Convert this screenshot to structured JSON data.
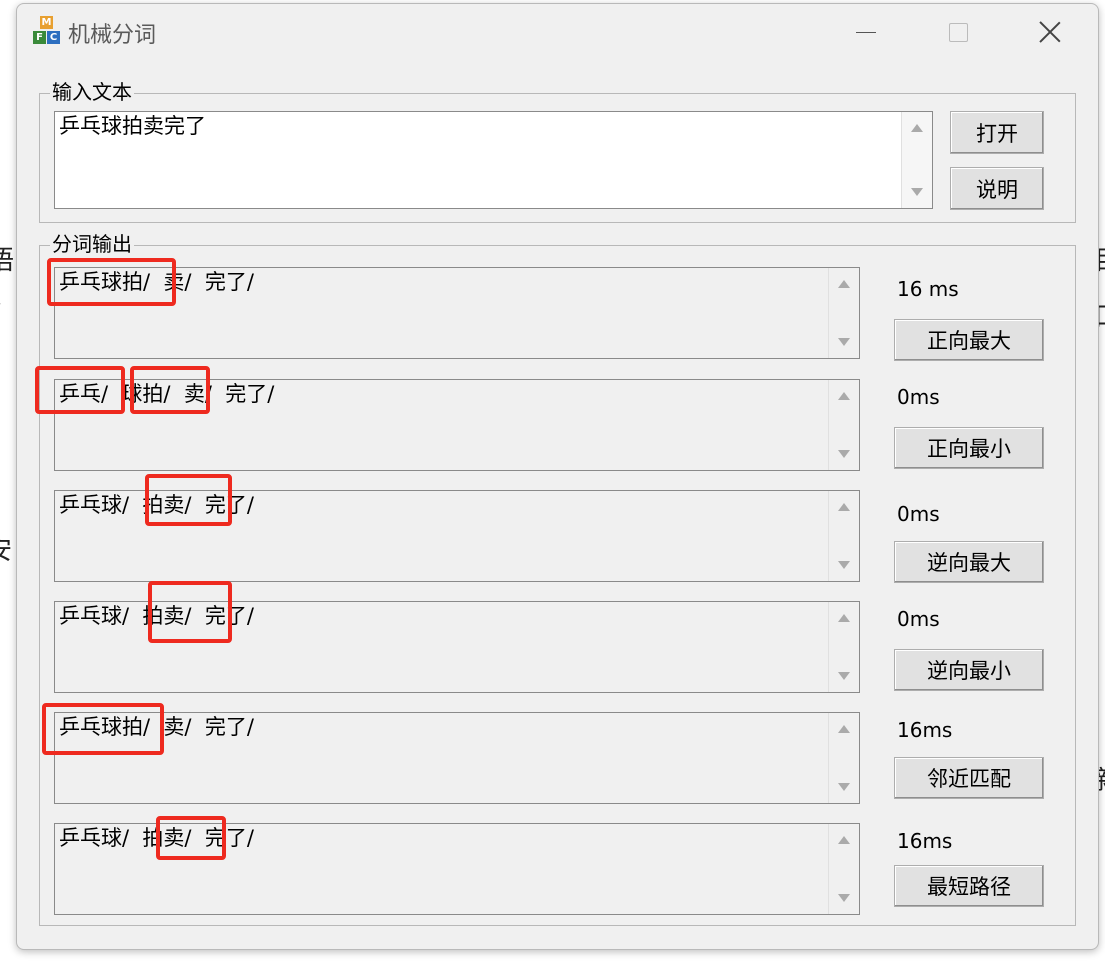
{
  "window": {
    "title": "机械分词",
    "icon_letters": [
      "M",
      "F",
      "C"
    ]
  },
  "input_group": {
    "label": "输入文本",
    "text": "乒乓球拍卖完了",
    "open_button": "打开",
    "help_button": "说明"
  },
  "output_group": {
    "label": "分词输出",
    "rows": [
      {
        "result": "乒乓球拍/  卖/  完了/",
        "time": "16 ms",
        "button": "正向最大"
      },
      {
        "result": "乒乓/  球拍/  卖/  完了/",
        "time": "0ms",
        "button": "正向最小"
      },
      {
        "result": "乒乓球/  拍卖/  完了/",
        "time": "0ms",
        "button": "逆向最大"
      },
      {
        "result": "乒乓球/  拍卖/  完了/",
        "time": "0ms",
        "button": "逆向最小"
      },
      {
        "result": "乒乓球拍/  卖/  完了/",
        "time": "16ms",
        "button": "邻近匹配"
      },
      {
        "result": "乒乓球/  拍卖/  完了/",
        "time": "16ms",
        "button": "最短路径"
      }
    ]
  },
  "background_fragments": [
    "语",
    "口",
    "安",
    "新",
    "目",
    "亻"
  ],
  "colors": {
    "highlight": "#ee2a1f",
    "window_bg": "#f0f0f0",
    "button_bg": "#e1e1e1"
  }
}
